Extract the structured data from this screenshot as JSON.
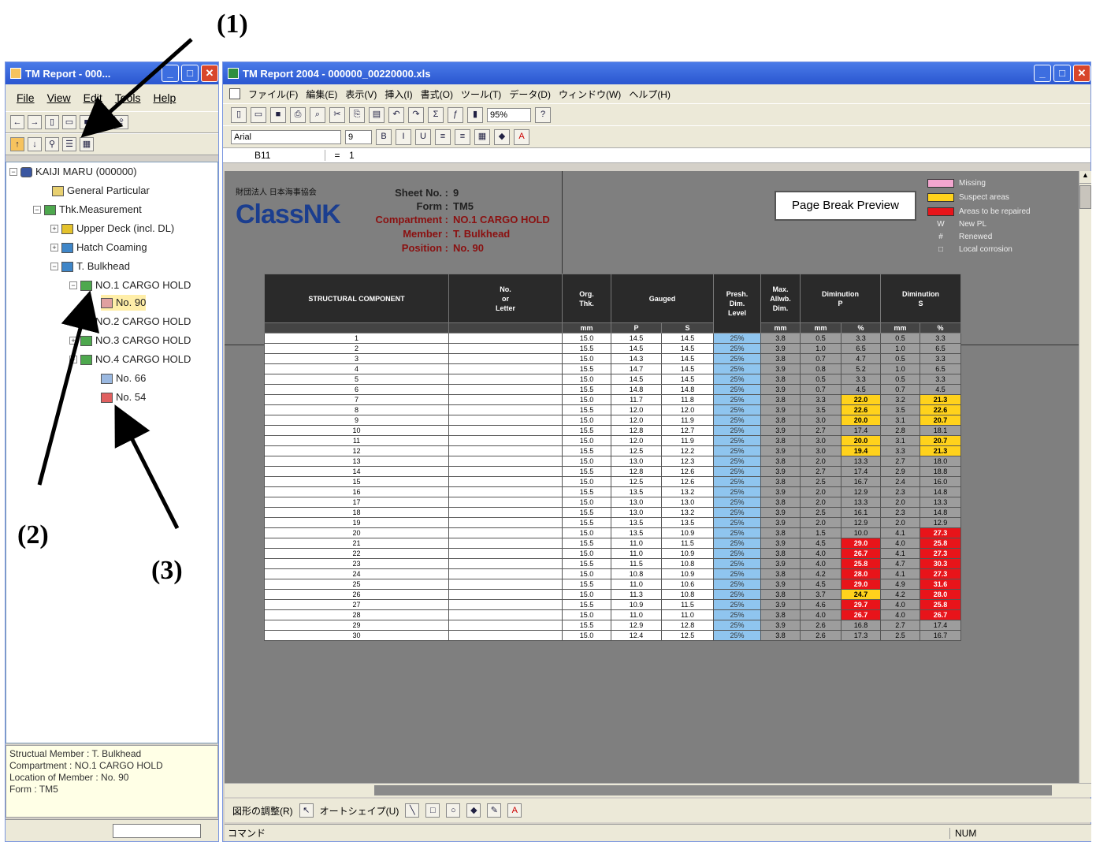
{
  "callouts": {
    "c1": "(1)",
    "c2": "(2)",
    "c3": "(3)"
  },
  "left_window": {
    "title": "TM Report - 000...",
    "menu": [
      "File",
      "View",
      "Edit",
      "Tools",
      "Help"
    ],
    "tree": {
      "root": "KAIJI MARU  (000000)",
      "general": "General Particular",
      "thk": "Thk.Measurement",
      "upper_deck": "Upper Deck (incl. DL)",
      "hatch": "Hatch Coaming",
      "bulkhead": "T. Bulkhead",
      "hold1": "NO.1 CARGO HOLD",
      "no90": "No. 90",
      "hold2": "NO.2 CARGO HOLD",
      "hold3": "NO.3 CARGO HOLD",
      "hold4": "NO.4 CARGO HOLD",
      "no66": "No. 66",
      "no54": "No. 54"
    },
    "info": [
      "Structual Member : T. Bulkhead",
      "Compartment : NO.1 CARGO HOLD",
      "Location of Member : No. 90",
      "Form : TM5"
    ]
  },
  "right_window": {
    "title": "TM Report 2004 - 000000_00220000.xls",
    "menu": [
      "ファイル(F)",
      "編集(E)",
      "表示(V)",
      "挿入(I)",
      "書式(O)",
      "ツール(T)",
      "データ(D)",
      "ウィンドウ(W)",
      "ヘルプ(H)"
    ],
    "zoom": "95%",
    "font": "Arial",
    "font_size": "9",
    "name_box": "B11",
    "formula": "1",
    "status_left": "コマンド",
    "status_num": "NUM",
    "draw_label": "図形の調整(R)",
    "autoshape": "オートシェイプ(U)"
  },
  "sheet": {
    "org": "財団法人 日本海事協会",
    "logo": "ClassNK",
    "sheet_no_label": "Sheet No. :",
    "sheet_no": "9",
    "form_label": "Form :",
    "form": "TM5",
    "comp_label": "Compartment :",
    "comp": "NO.1 CARGO HOLD",
    "member_label": "Member :",
    "member": "T. Bulkhead",
    "position_label": "Position :",
    "position": "No. 90",
    "pbp": "Page Break Preview",
    "legend": [
      {
        "color": "#f3a6cf",
        "label": "Missing"
      },
      {
        "color": "#ffd21c",
        "label": "Suspect areas"
      },
      {
        "color": "#e8141a",
        "label": "Areas to be repaired"
      },
      {
        "sym": "W",
        "label": "New PL"
      },
      {
        "sym": "#",
        "label": "Renewed"
      },
      {
        "sym": "□",
        "label": "Local corrosion"
      }
    ],
    "headers": {
      "component": "STRUCTURAL COMPONENT",
      "no": "No.\nor\nLetter",
      "org": "Org.\nThk.",
      "gauged": "Gauged",
      "presh": "Presh.\nDim.\nLevel",
      "max": "Max.\nAllwb.\nDim.",
      "dimp": "Diminution\nP",
      "dims": "Diminution\nS",
      "unit_mm": "mm",
      "unit_p": "P",
      "unit_s": "S",
      "unit_pct": "%"
    },
    "rows": [
      [
        "1",
        "15.0",
        "14.5",
        "14.5",
        "25%",
        "3.8",
        "0.5",
        "3.3",
        "0.5",
        "3.3"
      ],
      [
        "2",
        "15.5",
        "14.5",
        "14.5",
        "25%",
        "3.9",
        "1.0",
        "6.5",
        "1.0",
        "6.5"
      ],
      [
        "3",
        "15.0",
        "14.3",
        "14.5",
        "25%",
        "3.8",
        "0.7",
        "4.7",
        "0.5",
        "3.3"
      ],
      [
        "4",
        "15.5",
        "14.7",
        "14.5",
        "25%",
        "3.9",
        "0.8",
        "5.2",
        "1.0",
        "6.5"
      ],
      [
        "5",
        "15.0",
        "14.5",
        "14.5",
        "25%",
        "3.8",
        "0.5",
        "3.3",
        "0.5",
        "3.3"
      ],
      [
        "6",
        "15.5",
        "14.8",
        "14.8",
        "25%",
        "3.9",
        "0.7",
        "4.5",
        "0.7",
        "4.5"
      ],
      [
        "7",
        "15.0",
        "11.7",
        "11.8",
        "25%",
        "3.8",
        "3.3",
        "22.0",
        "3.2",
        "21.3"
      ],
      [
        "8",
        "15.5",
        "12.0",
        "12.0",
        "25%",
        "3.9",
        "3.5",
        "22.6",
        "3.5",
        "22.6"
      ],
      [
        "9",
        "15.0",
        "12.0",
        "11.9",
        "25%",
        "3.8",
        "3.0",
        "20.0",
        "3.1",
        "20.7"
      ],
      [
        "10",
        "15.5",
        "12.8",
        "12.7",
        "25%",
        "3.9",
        "2.7",
        "17.4",
        "2.8",
        "18.1"
      ],
      [
        "11",
        "15.0",
        "12.0",
        "11.9",
        "25%",
        "3.8",
        "3.0",
        "20.0",
        "3.1",
        "20.7"
      ],
      [
        "12",
        "15.5",
        "12.5",
        "12.2",
        "25%",
        "3.9",
        "3.0",
        "19.4",
        "3.3",
        "21.3"
      ],
      [
        "13",
        "15.0",
        "13.0",
        "12.3",
        "25%",
        "3.8",
        "2.0",
        "13.3",
        "2.7",
        "18.0"
      ],
      [
        "14",
        "15.5",
        "12.8",
        "12.6",
        "25%",
        "3.9",
        "2.7",
        "17.4",
        "2.9",
        "18.8"
      ],
      [
        "15",
        "15.0",
        "12.5",
        "12.6",
        "25%",
        "3.8",
        "2.5",
        "16.7",
        "2.4",
        "16.0"
      ],
      [
        "16",
        "15.5",
        "13.5",
        "13.2",
        "25%",
        "3.9",
        "2.0",
        "12.9",
        "2.3",
        "14.8"
      ],
      [
        "17",
        "15.0",
        "13.0",
        "13.0",
        "25%",
        "3.8",
        "2.0",
        "13.3",
        "2.0",
        "13.3"
      ],
      [
        "18",
        "15.5",
        "13.0",
        "13.2",
        "25%",
        "3.9",
        "2.5",
        "16.1",
        "2.3",
        "14.8"
      ],
      [
        "19",
        "15.5",
        "13.5",
        "13.5",
        "25%",
        "3.9",
        "2.0",
        "12.9",
        "2.0",
        "12.9"
      ],
      [
        "20",
        "15.0",
        "13.5",
        "10.9",
        "25%",
        "3.8",
        "1.5",
        "10.0",
        "4.1",
        "27.3"
      ],
      [
        "21",
        "15.5",
        "11.0",
        "11.5",
        "25%",
        "3.9",
        "4.5",
        "29.0",
        "4.0",
        "25.8"
      ],
      [
        "22",
        "15.0",
        "11.0",
        "10.9",
        "25%",
        "3.8",
        "4.0",
        "26.7",
        "4.1",
        "27.3"
      ],
      [
        "23",
        "15.5",
        "11.5",
        "10.8",
        "25%",
        "3.9",
        "4.0",
        "25.8",
        "4.7",
        "30.3"
      ],
      [
        "24",
        "15.0",
        "10.8",
        "10.9",
        "25%",
        "3.8",
        "4.2",
        "28.0",
        "4.1",
        "27.3"
      ],
      [
        "25",
        "15.5",
        "11.0",
        "10.6",
        "25%",
        "3.9",
        "4.5",
        "29.0",
        "4.9",
        "31.6"
      ],
      [
        "26",
        "15.0",
        "11.3",
        "10.8",
        "25%",
        "3.8",
        "3.7",
        "24.7",
        "4.2",
        "28.0"
      ],
      [
        "27",
        "15.5",
        "10.9",
        "11.5",
        "25%",
        "3.9",
        "4.6",
        "29.7",
        "4.0",
        "25.8"
      ],
      [
        "28",
        "15.0",
        "11.0",
        "11.0",
        "25%",
        "3.8",
        "4.0",
        "26.7",
        "4.0",
        "26.7"
      ],
      [
        "29",
        "15.5",
        "12.9",
        "12.8",
        "25%",
        "3.9",
        "2.6",
        "16.8",
        "2.7",
        "17.4"
      ],
      [
        "30",
        "15.0",
        "12.4",
        "12.5",
        "25%",
        "3.8",
        "2.6",
        "17.3",
        "2.5",
        "16.7"
      ]
    ]
  }
}
